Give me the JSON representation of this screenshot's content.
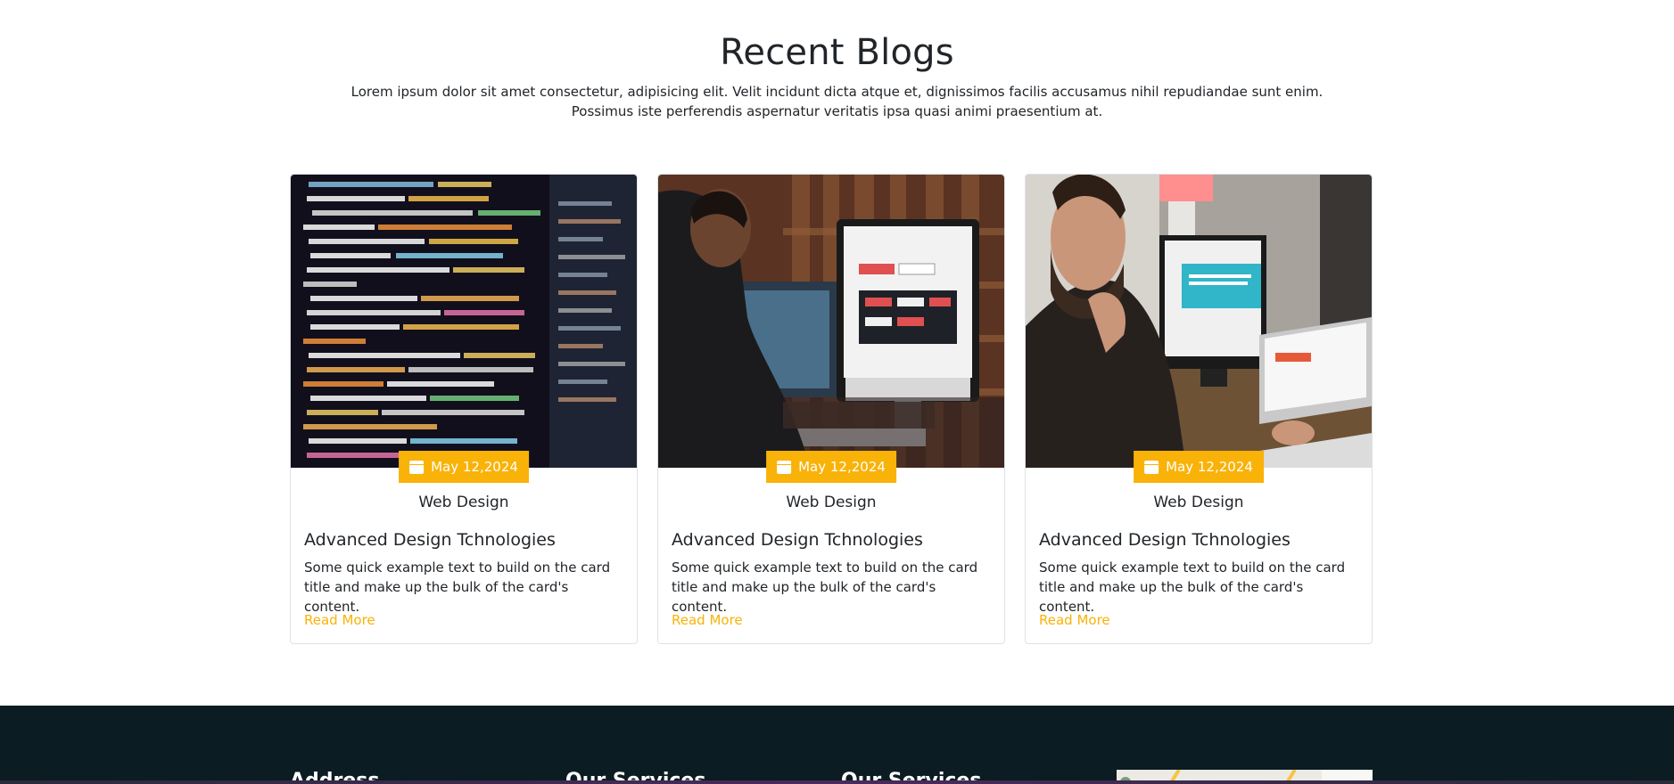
{
  "blogs": {
    "title": "Recent Blogs",
    "intro": "Lorem ipsum dolor sit amet consectetur, adipisicing elit. Velit incidunt dicta atque et, dignissimos facilis accusamus nihil repudiandae sunt enim. Possimus iste perferendis aspernatur veritatis ipsa quasi animi praesentium at.",
    "cards": [
      {
        "image": "code-screen-photo",
        "date": "May 12,2024",
        "category": "Web Design",
        "title": "Advanced Design Tchnologies",
        "text": "Some quick example text to build on the card title and make up the bulk of the card's content.",
        "link": "Read More"
      },
      {
        "image": "designer-at-imac-photo",
        "date": "May 12,2024",
        "category": "Web Design",
        "title": "Advanced Design Tchnologies",
        "text": "Some quick example text to build on the card title and make up the bulk of the card's content.",
        "link": "Read More"
      },
      {
        "image": "man-at-laptop-photo",
        "date": "May 12,2024",
        "category": "Web Design",
        "title": "Advanced Design Tchnologies",
        "text": "Some quick example text to build on the card title and make up the bulk of the card's content.",
        "link": "Read More"
      }
    ]
  },
  "footer": {
    "headings": [
      "Address",
      "Our Services",
      "Our Services"
    ]
  },
  "colors": {
    "accent": "#f9b208",
    "footer_bg": "#0b1c22",
    "text": "#212529"
  }
}
